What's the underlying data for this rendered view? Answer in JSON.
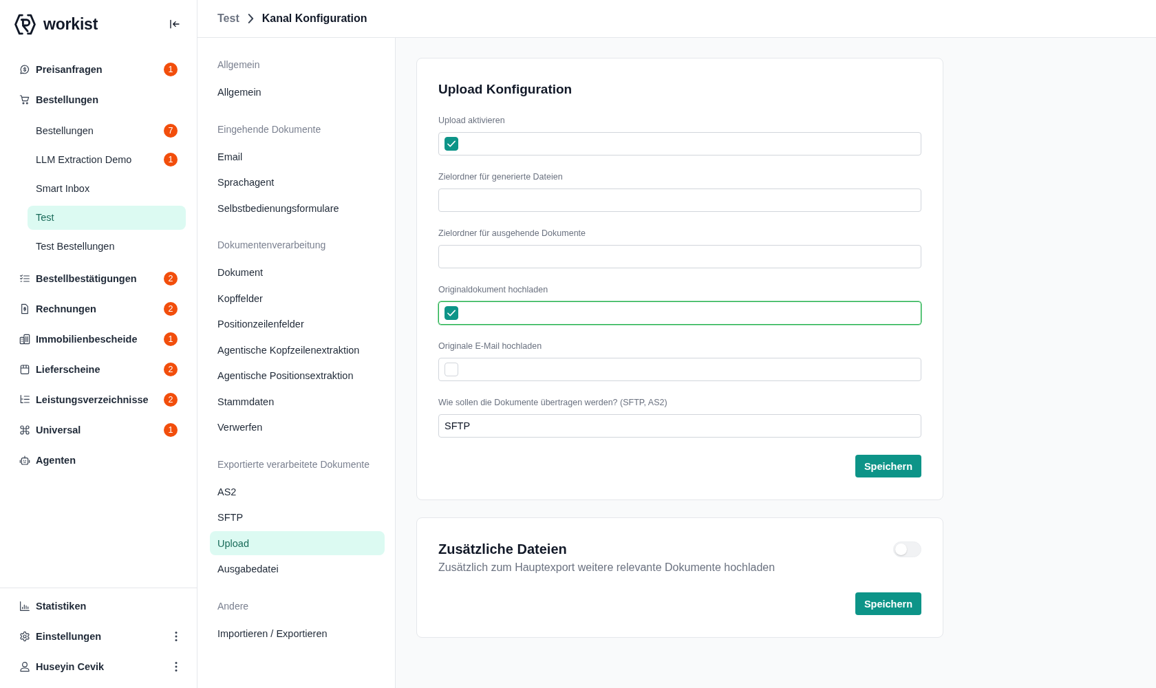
{
  "sidebar": {
    "logo": "workist",
    "nav": [
      {
        "label": "Preisanfragen",
        "badge": "1",
        "selected": false
      },
      {
        "label": "Bestellungen",
        "selected": false,
        "children": [
          {
            "label": "Bestellungen",
            "badge": "7",
            "selected": false
          },
          {
            "label": "LLM Extraction Demo",
            "badge": "1",
            "selected": false
          },
          {
            "label": "Smart Inbox",
            "selected": false
          },
          {
            "label": "Test",
            "selected": true
          },
          {
            "label": "Test Bestellungen",
            "selected": false
          }
        ]
      },
      {
        "label": "Bestellbestätigungen",
        "badge": "2",
        "selected": false
      },
      {
        "label": "Rechnungen",
        "badge": "2",
        "selected": false
      },
      {
        "label": "Immobilienbescheide",
        "badge": "1",
        "selected": false
      },
      {
        "label": "Lieferscheine",
        "badge": "2",
        "selected": false
      },
      {
        "label": "Leistungsverzeichnisse",
        "badge": "2",
        "selected": false
      },
      {
        "label": "Universal",
        "badge": "1",
        "selected": false
      },
      {
        "label": "Agenten",
        "selected": false
      }
    ],
    "footer": [
      {
        "label": "Statistiken",
        "menu": false,
        "selected": false
      },
      {
        "label": "Einstellungen",
        "menu": true,
        "selected": false
      },
      {
        "label": "Huseyin Cevik",
        "menu": true,
        "selected": false
      }
    ]
  },
  "breadcrumb": [
    {
      "label": "Test",
      "current": false
    },
    {
      "label": "Kanal Konfiguration",
      "current": true
    }
  ],
  "settings_nav": [
    {
      "heading": "Allgemein",
      "items": [
        {
          "label": "Allgemein",
          "selected": false
        }
      ]
    },
    {
      "heading": "Eingehende Dokumente",
      "items": [
        {
          "label": "Email",
          "selected": false
        },
        {
          "label": "Sprachagent",
          "selected": false
        },
        {
          "label": "Selbstbedienungsformulare",
          "selected": false
        }
      ]
    },
    {
      "heading": "Dokumentenverarbeitung",
      "items": [
        {
          "label": "Dokument",
          "selected": false
        },
        {
          "label": "Kopffelder",
          "selected": false
        },
        {
          "label": "Positionzeilenfelder",
          "selected": false
        },
        {
          "label": "Agentische Kopfzeilenextraktion",
          "selected": false
        },
        {
          "label": "Agentische Positionsextraktion",
          "selected": false
        },
        {
          "label": "Stammdaten",
          "selected": false
        },
        {
          "label": "Verwerfen",
          "selected": false
        }
      ]
    },
    {
      "heading": "Exportierte verarbeitete Dokumente",
      "items": [
        {
          "label": "AS2",
          "selected": false
        },
        {
          "label": "SFTP",
          "selected": false
        },
        {
          "label": "Upload",
          "selected": true
        },
        {
          "label": "Ausgabedatei",
          "selected": false
        }
      ]
    },
    {
      "heading": "Andere",
      "items": [
        {
          "label": "Importieren / Exportieren",
          "selected": false
        }
      ]
    }
  ],
  "upload_card": {
    "title": "Upload Konfiguration",
    "fields": [
      {
        "kind": "checkbox",
        "label": "Upload aktivieren",
        "checked": true,
        "focused": false
      },
      {
        "kind": "text",
        "label": "Zielordner für generierte Dateien",
        "focused": false
      },
      {
        "kind": "text",
        "label": "Zielordner für ausgehende Dokumente",
        "focused": false
      },
      {
        "kind": "checkbox",
        "label": "Originaldokument hochladen",
        "checked": true,
        "focused": true
      },
      {
        "kind": "checkbox",
        "label": "Originale E-Mail hochladen",
        "checked": false,
        "focused": false
      },
      {
        "kind": "text",
        "label": "Wie sollen die Dokumente übertragen werden? (SFTP, AS2)",
        "value": "SFTP",
        "focused": false
      }
    ],
    "button": "Speichern"
  },
  "extra_files_card": {
    "title": "Zusätzliche Dateien",
    "description": "Zusätzlich zum Hauptexport weitere relevante Dokumente hochladen",
    "on": false,
    "button": "Speichern"
  }
}
